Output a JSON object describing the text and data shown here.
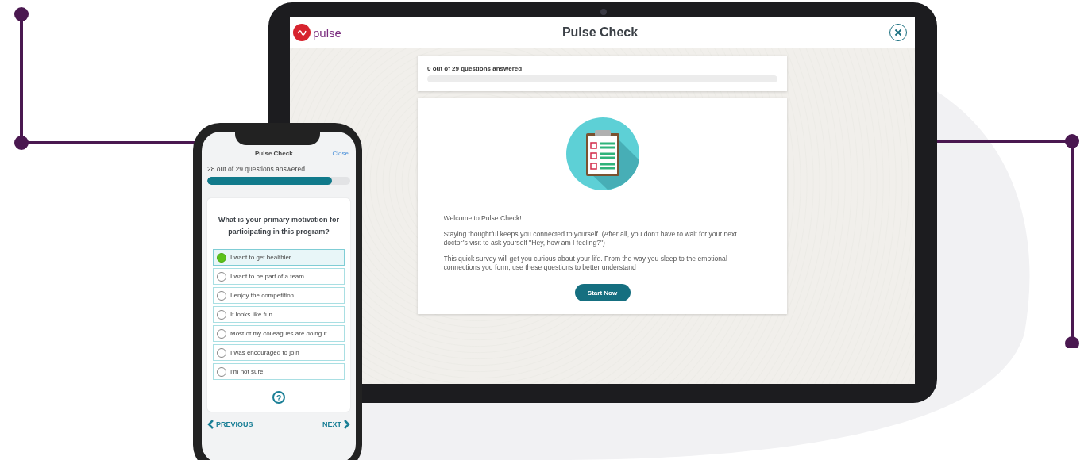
{
  "tablet": {
    "logo": "pulse",
    "title": "Pulse Check",
    "progress": {
      "label": "0 out of 29 questions answered",
      "level": 0
    },
    "intro": {
      "paragraphs": [
        "Welcome to Pulse Check!",
        "Staying thoughtful keeps you connected to yourself. (After all, you don’t have to wait for your next doctor’s visit to ask yourself \"Hey, how am I feeling?\")",
        "This quick survey will get you curious about your life.  From the way you sleep to the emotional connections you form, use these questions to better understand"
      ],
      "button": "Start Now"
    }
  },
  "phone": {
    "title": "Pulse Check",
    "close": "Close",
    "progress": {
      "label": "28 out of 29 questions answered",
      "level": 0.87
    },
    "question": "What is your primary motivation for participating in this program?",
    "options": [
      {
        "label": "I want to get healthier",
        "selected": true
      },
      {
        "label": "I want to be part of a team",
        "selected": false
      },
      {
        "label": "I enjoy the competition",
        "selected": false
      },
      {
        "label": "It looks like fun",
        "selected": false
      },
      {
        "label": "Most of my colleagues are doing it",
        "selected": false
      },
      {
        "label": "I was encouraged to join",
        "selected": false
      },
      {
        "label": "I'm not sure",
        "selected": false
      }
    ],
    "help": "?",
    "previous": "PREVIOUS",
    "next": "NEXT"
  }
}
